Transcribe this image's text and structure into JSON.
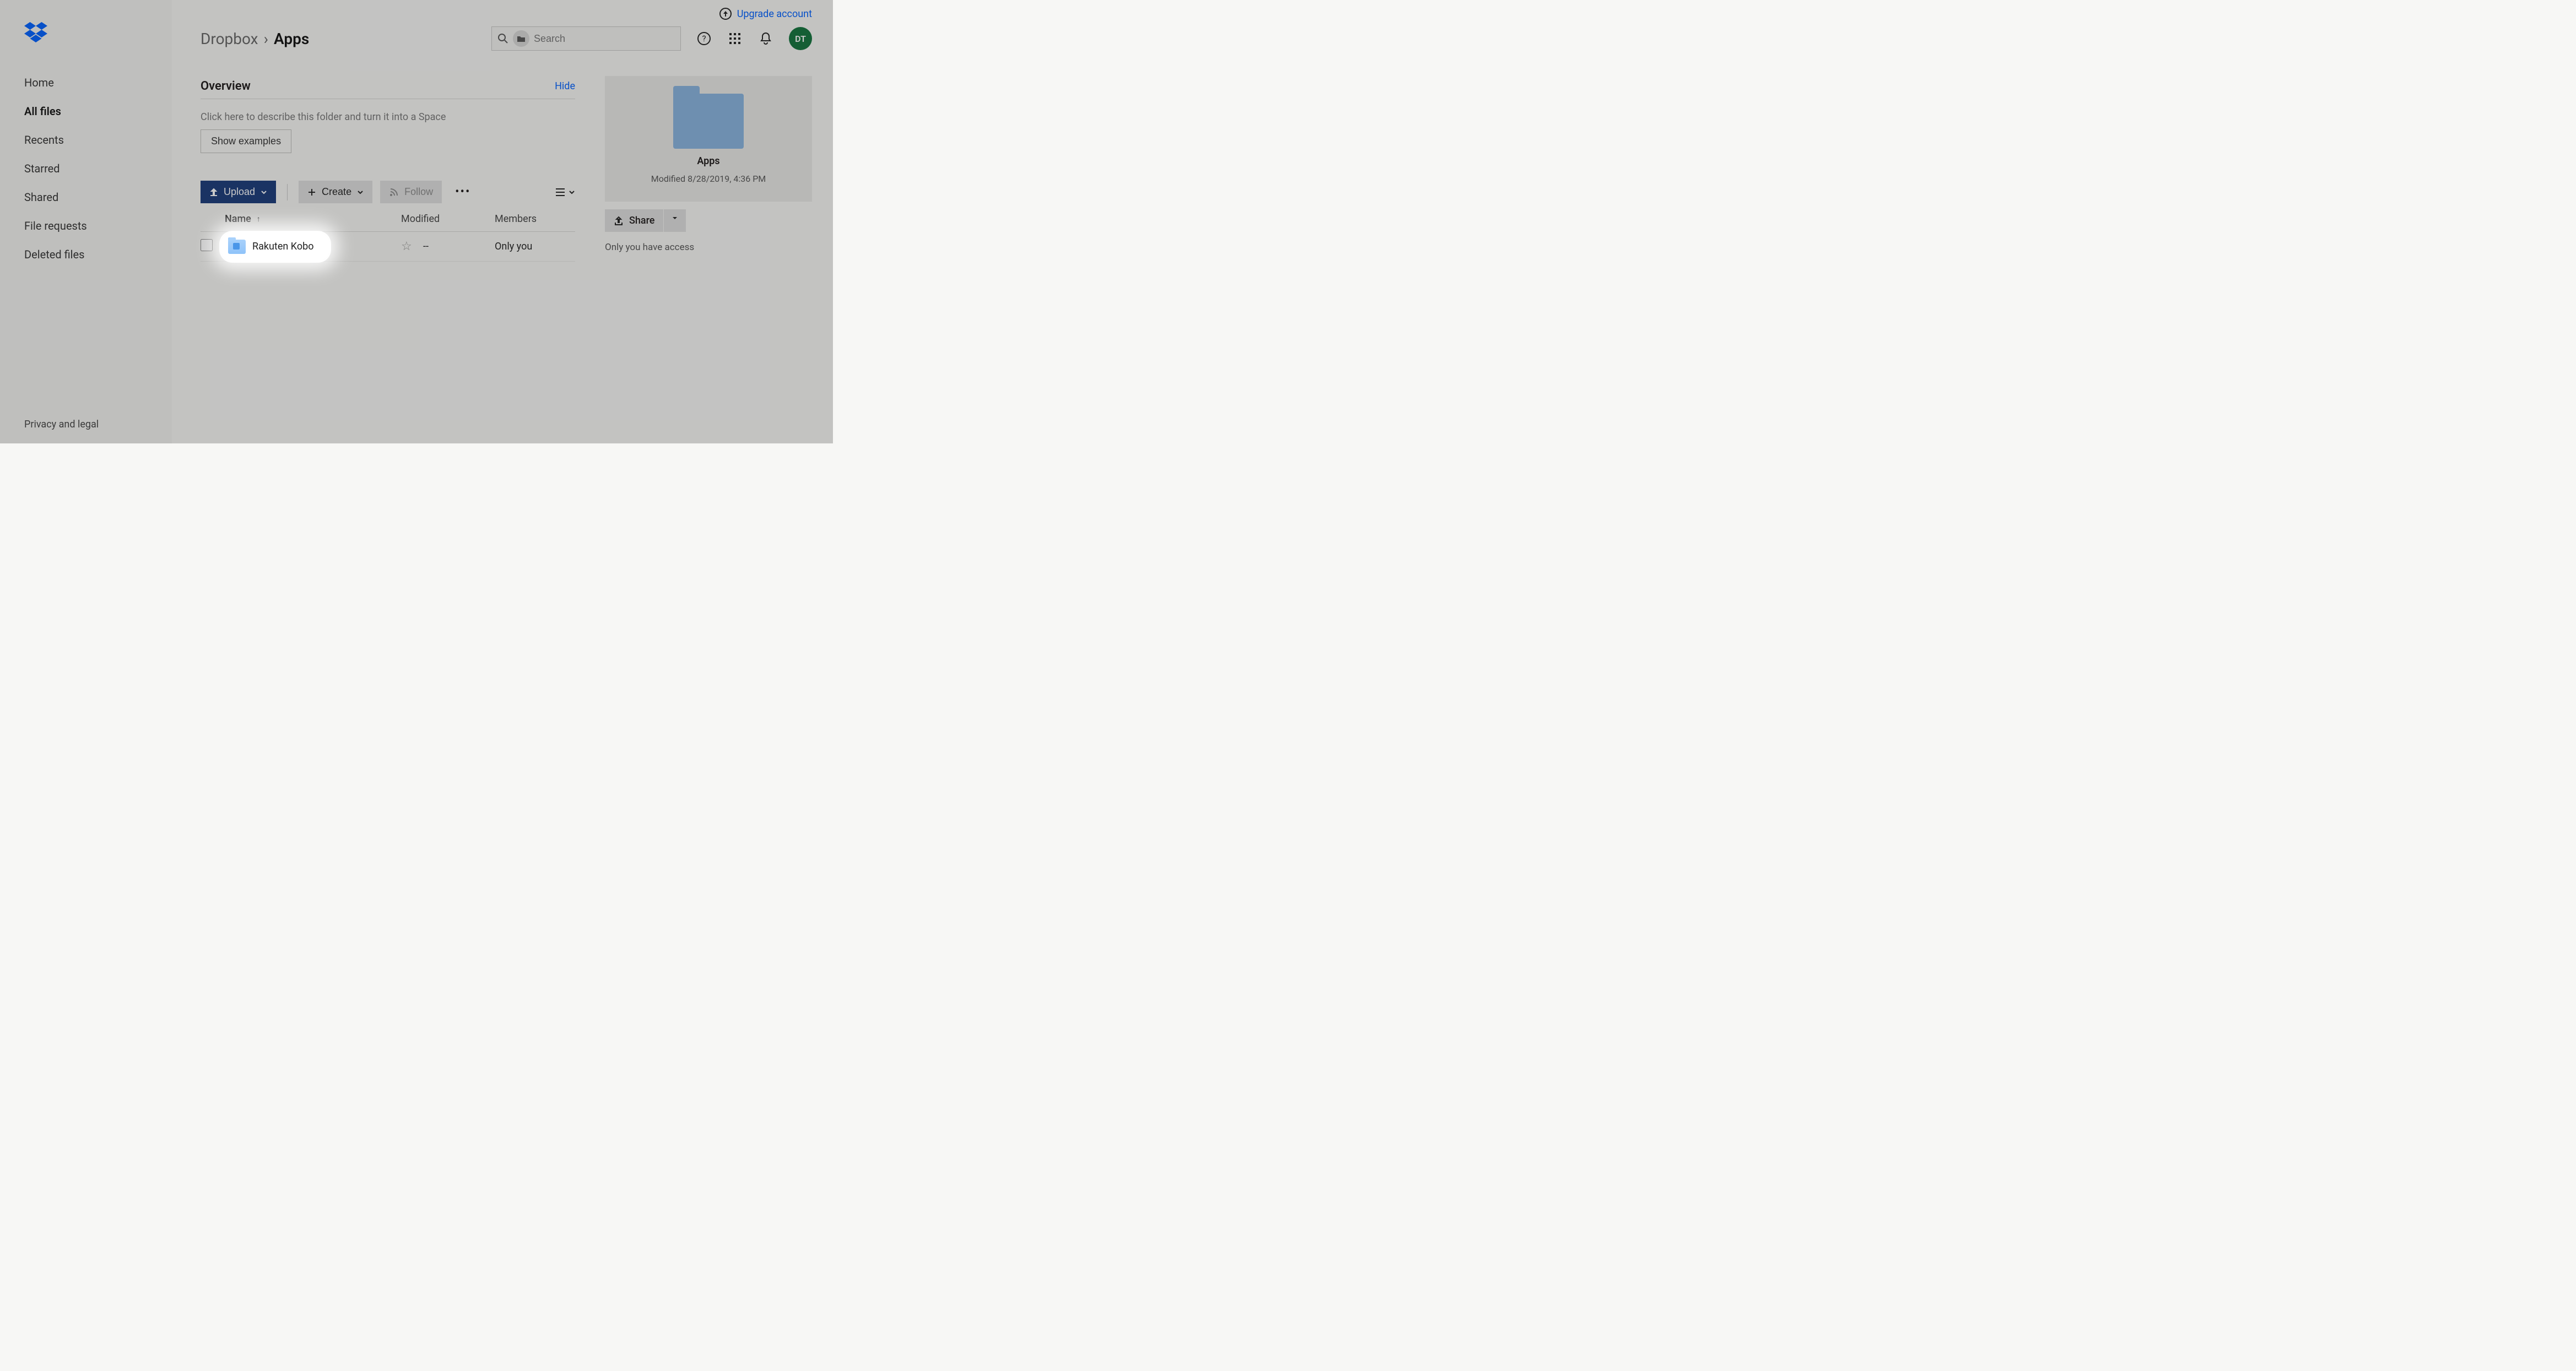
{
  "upgrade": {
    "label": "Upgrade account"
  },
  "breadcrumb": {
    "root": "Dropbox",
    "sep": "›",
    "current": "Apps"
  },
  "search": {
    "placeholder": "Search"
  },
  "avatar": {
    "initials": "DT"
  },
  "sidebar": {
    "items": [
      {
        "label": "Home"
      },
      {
        "label": "All files"
      },
      {
        "label": "Recents"
      },
      {
        "label": "Starred"
      },
      {
        "label": "Shared"
      },
      {
        "label": "File requests"
      },
      {
        "label": "Deleted files"
      }
    ],
    "footer": "Privacy and legal"
  },
  "overview": {
    "title": "Overview",
    "hide": "Hide",
    "describe": "Click here to describe this folder and turn it into a Space",
    "show_examples": "Show examples"
  },
  "toolbar": {
    "upload": "Upload",
    "create": "Create",
    "follow": "Follow"
  },
  "columns": {
    "name": "Name",
    "modified": "Modified",
    "members": "Members"
  },
  "rows": [
    {
      "name": "Rakuten Kobo",
      "modified": "--",
      "members": "Only you"
    }
  ],
  "details": {
    "name": "Apps",
    "modified": "Modified 8/28/2019, 4:36 PM",
    "share": "Share",
    "access": "Only you have access"
  }
}
